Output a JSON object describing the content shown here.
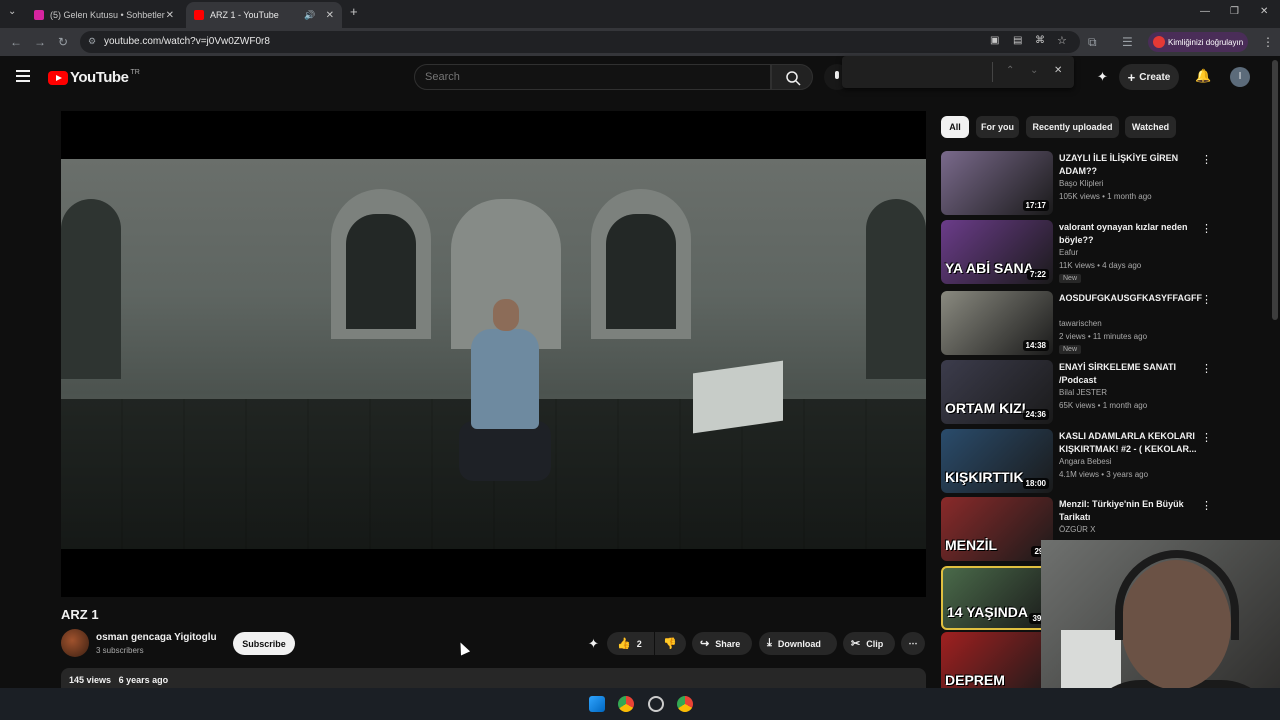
{
  "browser": {
    "tabs": [
      {
        "title": "(5) Gelen Kutusu • Sohbetler",
        "active": false,
        "icon": "instagram-icon",
        "color": "#d6249f"
      },
      {
        "title": "ARZ 1 - YouTube",
        "active": true,
        "icon": "youtube-icon",
        "color": "#ff0000"
      }
    ],
    "url": "youtube.com/watch?v=j0Vw0ZWF0r8",
    "profile_label": "Kimliğinizi doğrulayın"
  },
  "header": {
    "logo_text": "YouTube",
    "country_code": "TR",
    "search_placeholder": "Search",
    "create_label": "Create",
    "avatar_letter": "I"
  },
  "video": {
    "title": "ARZ 1",
    "channel_name": "osman gencaga Yigitoglu",
    "subscribers": "3 subscribers",
    "subscribe_label": "Subscribe",
    "likes": "2",
    "share_label": "Share",
    "download_label": "Download",
    "clip_label": "Clip",
    "views": "145 views",
    "age": "6 years ago"
  },
  "chips": [
    "All",
    "For you",
    "Recently uploaded",
    "Watched"
  ],
  "recommendations": [
    {
      "title": "UZAYLI İLE İLİŞKİYE GİREN ADAM??",
      "channel": "Başo Klipleri",
      "meta": "105K views • 1 month ago",
      "duration": "17:17",
      "badge": "",
      "thumb_text": "",
      "thumb_color": "#7a6a8c"
    },
    {
      "title": "valorant oynayan kızlar neden böyle??",
      "channel": "Eafur",
      "meta": "11K views • 4 days ago",
      "duration": "7:22",
      "badge": "New",
      "thumb_text": "YA ABİ SANA",
      "thumb_color": "#6b3c8a"
    },
    {
      "title": "AOSDUFGKAUSGFKASYFFAGFF",
      "channel": "tawarischen",
      "meta": "2 views • 11 minutes ago",
      "duration": "14:38",
      "badge": "New",
      "thumb_text": "",
      "thumb_color": "#8a8a80"
    },
    {
      "title": "ENAYİ SİRKELEME SANATI /Podcast",
      "channel": "Bilal JESTER",
      "meta": "65K views • 1 month ago",
      "duration": "24:36",
      "badge": "",
      "thumb_text": "ORTAM KIZI",
      "thumb_color": "#3c3c4c"
    },
    {
      "title": "KASLI ADAMLARLA KEKOLARI KIŞKIRTMAK! #2 - ( KEKOLAR...",
      "channel": "Angara Bebesi",
      "meta": "4.1M views • 3 years ago",
      "duration": "18:00",
      "badge": "",
      "thumb_text": "KIŞKIRTTIK",
      "thumb_color": "#2a4c6c"
    },
    {
      "title": "Menzil: Türkiye'nin En Büyük Tarikatı",
      "channel": "ÖZGÜR X",
      "meta": "",
      "duration": "29:",
      "badge": "",
      "thumb_text": "MENZİL",
      "thumb_color": "#8a2a2a"
    },
    {
      "title": "",
      "channel": "",
      "meta": "",
      "duration": "39:",
      "badge": "",
      "thumb_text": "14 YAŞINDA",
      "thumb_color": "#4a6a4a"
    },
    {
      "title": "",
      "channel": "",
      "meta": "",
      "duration": "",
      "badge": "",
      "thumb_text": "DEPREM",
      "thumb_color": "#a02020"
    }
  ]
}
